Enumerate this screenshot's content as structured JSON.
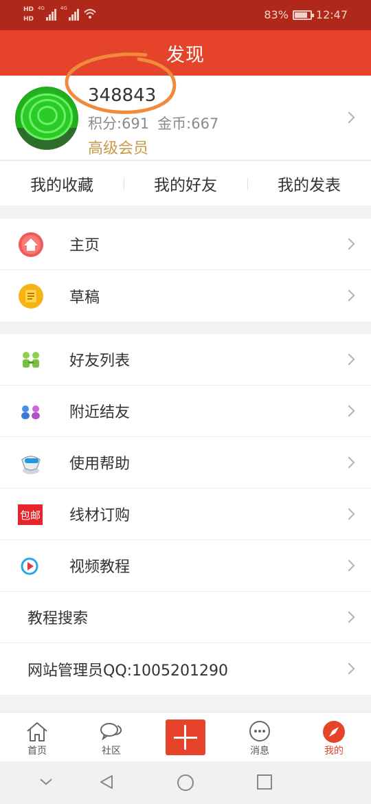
{
  "status_bar": {
    "hd1": "HD",
    "hd2": "HD",
    "net1": "4G",
    "net2": "4G",
    "battery_percent_text": "83%",
    "battery_level": 0.83,
    "time": "12:47"
  },
  "header": {
    "title": "发现"
  },
  "profile": {
    "user_id": "348843",
    "points": "积分:691",
    "coins": "金币:667",
    "level": "高级会员"
  },
  "quick_links": [
    {
      "label": "我的收藏"
    },
    {
      "label": "我的好友"
    },
    {
      "label": "我的发表"
    }
  ],
  "menu": {
    "group1": [
      {
        "label": "主页",
        "icon": "home-icon"
      },
      {
        "label": "草稿",
        "icon": "draft-icon"
      }
    ],
    "group2": [
      {
        "label": "好友列表",
        "icon": "friends-list-icon"
      },
      {
        "label": "附近结友",
        "icon": "nearby-people-icon"
      },
      {
        "label": "使用帮助",
        "icon": "help-icon"
      },
      {
        "label": "线材订购",
        "icon": "free-shipping-icon",
        "icon_text": "包邮"
      },
      {
        "label": "视频教程",
        "icon": "video-play-icon"
      },
      {
        "label": "教程搜索"
      },
      {
        "label": "网站管理员QQ:1005201290"
      }
    ]
  },
  "bottom_nav": [
    {
      "label": "首页",
      "icon": "home-outline-icon"
    },
    {
      "label": "社区",
      "icon": "chat-bubbles-icon"
    },
    {
      "label": "",
      "icon": "plus-icon"
    },
    {
      "label": "消息",
      "icon": "message-dots-icon"
    },
    {
      "label": "我的",
      "icon": "compass-icon",
      "active": true
    }
  ],
  "colors": {
    "status_bar": "#b0281a",
    "header": "#e5432a",
    "accent": "#e5432a",
    "level_text": "#c89a47",
    "annotation": "#f08a3c"
  }
}
